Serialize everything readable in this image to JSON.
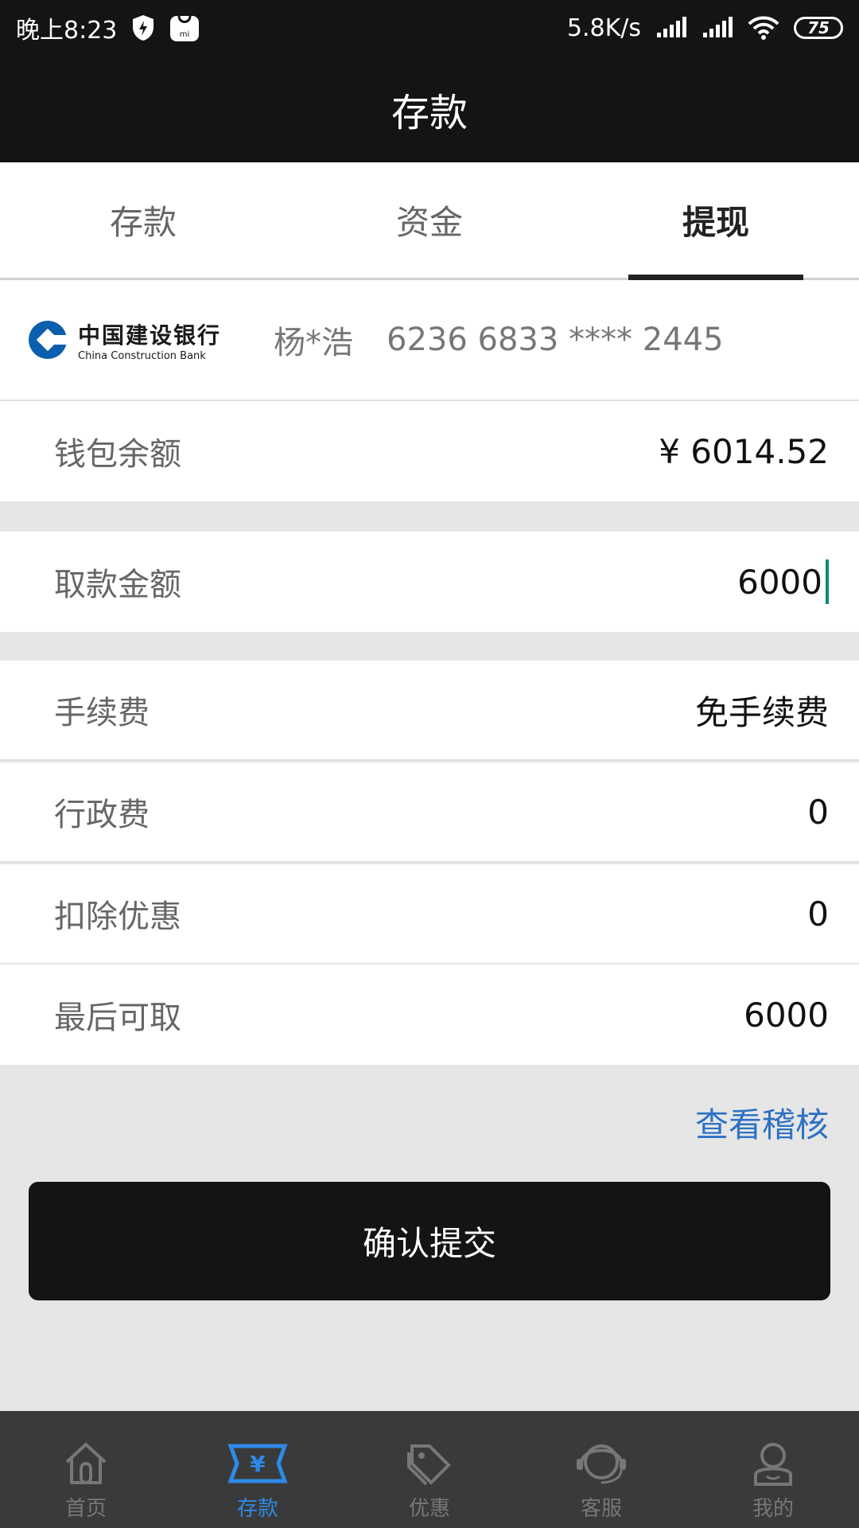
{
  "status_bar": {
    "time": "晚上8:23",
    "net_speed": "5.8K/s",
    "battery": "75"
  },
  "header": {
    "title": "存款"
  },
  "tabs": [
    {
      "label": "存款",
      "active": false
    },
    {
      "label": "资金",
      "active": false
    },
    {
      "label": "提现",
      "active": true
    }
  ],
  "bank": {
    "name_cn": "中国建设银行",
    "name_en": "China Construction Bank",
    "holder": "杨*浩",
    "card_number": "6236 6833 **** 2445",
    "brand_color": "#0b5fae"
  },
  "balance": {
    "label": "钱包余额",
    "value": "¥ 6014.52"
  },
  "withdraw": {
    "label": "取款金额",
    "value": "6000"
  },
  "fees": [
    {
      "label": "手续费",
      "value": "免手续费"
    },
    {
      "label": "行政费",
      "value": "0"
    },
    {
      "label": "扣除优惠",
      "value": "0"
    },
    {
      "label": "最后可取",
      "value": "6000"
    }
  ],
  "audit_link": "查看稽核",
  "submit_label": "确认提交",
  "bottom_nav": [
    {
      "label": "首页",
      "icon": "home-icon",
      "active": false
    },
    {
      "label": "存款",
      "icon": "yuan-card-icon",
      "active": true
    },
    {
      "label": "优惠",
      "icon": "tag-icon",
      "active": false
    },
    {
      "label": "客服",
      "icon": "headset-icon",
      "active": false
    },
    {
      "label": "我的",
      "icon": "user-icon",
      "active": false
    }
  ],
  "colors": {
    "dark": "#141414",
    "accent_link": "#2d72c4",
    "nav_active": "#2d8ae8",
    "caret": "#0a8a7a"
  }
}
